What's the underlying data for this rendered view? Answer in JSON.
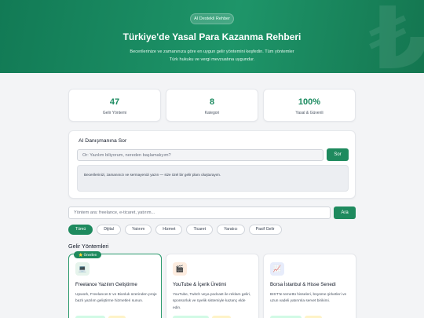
{
  "hero": {
    "badge": "AI Destekli Rehber",
    "title": "Türkiye'de Yasal Para Kazanma Rehberi",
    "subtitle": "Becerilerinize ve zamanınıza göre en uygun gelir yöntemini keşfedin. Tüm yöntemler Türk hukuku ve vergi mevzuatına uygundur.",
    "watermark_glyph": "₺"
  },
  "stats": [
    {
      "value": "47",
      "label": "Gelir Yöntemi"
    },
    {
      "value": "8",
      "label": "Kategori"
    },
    {
      "value": "100%",
      "label": "Yasal & Güvenli"
    }
  ],
  "ai": {
    "title": "AI Danışmanına Sor",
    "placeholder": "Ör: Yazılım biliyorum, nereden başlamalıyım?",
    "button": "Sor",
    "answer": "Becerilerinizi, zamanınızı ve sermayenizi yazın — size özel bir gelir planı oluşturayım."
  },
  "search": {
    "placeholder": "Yöntem ara: freelance, e-ticaret, yatırım...",
    "button": "Ara"
  },
  "filters": [
    "Tümü",
    "Dijital",
    "Yatırım",
    "Hizmet",
    "Ticaret",
    "Yaratıcı",
    "Pasif Gelir"
  ],
  "active_filter": "Tümü",
  "section_title": "Gelir Yöntemleri",
  "cards": [
    {
      "badge": "⭐ Önerilen",
      "icon": "laptop-icon",
      "glyph": "💻",
      "title": "Freelance Yazılım Geliştirme",
      "desc": "Upwork, Freelancer.tr ve Bionluk üzerinden proje bazlı yazılım geliştirme hizmetleri sunun."
    },
    {
      "badge": "",
      "icon": "clapper-icon",
      "glyph": "🎬",
      "title": "YouTube & İçerik Üretimi",
      "desc": "YouTube, Twitch veya podcast ile reklam geliri, sponsorluk ve üyelik sistemiyle kazanç elde edin."
    },
    {
      "badge": "",
      "icon": "chart-up-icon",
      "glyph": "📈",
      "title": "Borsa İstanbul & Hisse Senedi",
      "desc": "BIST'te temettü hisseleri, büyüme şirketleri ve uzun vadeli yatırımla servet birikimi."
    }
  ],
  "colors": {
    "brand": "#1e8a5e",
    "accent_text": "#1a8a5f"
  }
}
